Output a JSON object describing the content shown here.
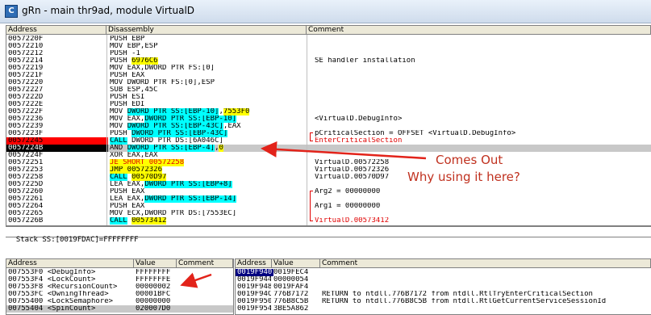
{
  "window": {
    "title": "gRn - main thr9ad, module VirtualD",
    "icon": "C"
  },
  "disasm": {
    "headers": [
      "Address",
      "Disassembly",
      "Comment"
    ],
    "rows": [
      {
        "addr": "0057220F",
        "asm": [
          {
            "t": "PUSH EBP"
          }
        ],
        "comment": ""
      },
      {
        "addr": "00572210",
        "asm": [
          {
            "t": "MOV EBP,ESP"
          }
        ],
        "comment": ""
      },
      {
        "addr": "00572212",
        "asm": [
          {
            "t": "PUSH -1"
          }
        ],
        "comment": ""
      },
      {
        "addr": "00572214",
        "asm": [
          {
            "t": "PUSH "
          },
          {
            "t": "6976C6",
            "s": "yellow"
          }
        ],
        "comment": "SE handler installation"
      },
      {
        "addr": "00572219",
        "asm": [
          {
            "t": "MOV EAX,DWORD PTR FS:[0]"
          }
        ],
        "comment": ""
      },
      {
        "addr": "0057221F",
        "asm": [
          {
            "t": "PUSH EAX"
          }
        ],
        "comment": ""
      },
      {
        "addr": "00572220",
        "asm": [
          {
            "t": "MOV DWORD PTR FS:[0],ESP"
          }
        ],
        "comment": ""
      },
      {
        "addr": "00572227",
        "asm": [
          {
            "t": "SUB ESP,45C"
          }
        ],
        "comment": ""
      },
      {
        "addr": "0057222D",
        "asm": [
          {
            "t": "PUSH ESI"
          }
        ],
        "comment": ""
      },
      {
        "addr": "0057222E",
        "asm": [
          {
            "t": "PUSH EDI"
          }
        ],
        "comment": ""
      },
      {
        "addr": "0057222F",
        "asm": [
          {
            "t": "MOV "
          },
          {
            "t": "DWORD PTR SS:[EBP-10]",
            "s": "cyan"
          },
          {
            "t": ","
          },
          {
            "t": "7553F0",
            "s": "yellow"
          }
        ],
        "comment": ""
      },
      {
        "addr": "00572236",
        "asm": [
          {
            "t": "MOV EAX,"
          },
          {
            "t": "DWORD PTR SS:[EBP-10]",
            "s": "cyan"
          }
        ],
        "comment": "<VirtualD.DebugInfo>"
      },
      {
        "addr": "00572239",
        "asm": [
          {
            "t": "MOV "
          },
          {
            "t": "DWORD PTR SS:[EBP-43C]",
            "s": "cyan"
          },
          {
            "t": ",EAX"
          }
        ],
        "comment": ""
      },
      {
        "addr": "0057223F",
        "asm": [
          {
            "t": "PUSH "
          },
          {
            "t": "DWORD PTR SS:[EBP-43C]",
            "s": "cyan"
          }
        ],
        "comment": "pCriticalSection = OFFSET <VirtualD.DebugInfo>",
        "bracket": "top"
      },
      {
        "addr": "00572245",
        "asm": [
          {
            "t": "CALL",
            "s": "cyan"
          },
          {
            "t": " DWORD PTR DS:[6A046C]"
          }
        ],
        "comment": "EnterCriticalSection",
        "commentColor": "red",
        "addrSel": "red"
      },
      {
        "addr": "0057224B",
        "asm": [
          {
            "t": "AND "
          },
          {
            "t": "DWORD PTR SS:[EBP-4]",
            "s": "cyan"
          },
          {
            "t": ","
          },
          {
            "t": "0",
            "s": "yellow"
          }
        ],
        "comment": "",
        "addrSel": "black",
        "rowSel": "gray"
      },
      {
        "addr": "0057224F",
        "asm": [
          {
            "t": "XOR EAX,EAX"
          }
        ],
        "comment": ""
      },
      {
        "addr": "00572251",
        "asm": [
          {
            "t": "JE SHORT 00572258",
            "s": "yellow",
            "red": true
          }
        ],
        "comment": "VirtualD.00572258"
      },
      {
        "addr": "00572253",
        "asm": [
          {
            "t": "JMP 00572326",
            "s": "yellow"
          }
        ],
        "comment": "VirtualD.00572326"
      },
      {
        "addr": "00572258",
        "asm": [
          {
            "t": "CALL",
            "s": "cyan"
          },
          {
            "t": " "
          },
          {
            "t": "00570D97",
            "s": "yellow"
          }
        ],
        "comment": "VirtualD.00570D97"
      },
      {
        "addr": "0057225D",
        "asm": [
          {
            "t": "LEA EAX,"
          },
          {
            "t": "DWORD PTR SS:[EBP+8]",
            "s": "cyan"
          }
        ],
        "comment": ""
      },
      {
        "addr": "00572260",
        "asm": [
          {
            "t": "PUSH EAX"
          }
        ],
        "comment": "Arg2 = 00000000"
      },
      {
        "addr": "00572261",
        "asm": [
          {
            "t": "LEA EAX,"
          },
          {
            "t": "DWORD PTR SS:[EBP-14]",
            "s": "cyan"
          }
        ],
        "comment": ""
      },
      {
        "addr": "00572264",
        "asm": [
          {
            "t": "PUSH EAX"
          }
        ],
        "comment": "Arg1 = 00000000"
      },
      {
        "addr": "00572265",
        "asm": [
          {
            "t": "MOV ECX,DWORD PTR DS:[7553EC]"
          }
        ],
        "comment": ""
      },
      {
        "addr": "0057226B",
        "asm": [
          {
            "t": "CALL",
            "s": "cyan"
          },
          {
            "t": " "
          },
          {
            "t": "00573412",
            "s": "yellow"
          }
        ],
        "comment": "VirtualD.00573412",
        "commentColor": "red"
      }
    ]
  },
  "info_bar": "Stack SS:[0019FDAC]=FFFFFFFF",
  "dump": {
    "headers": [
      "Address",
      "Value",
      "Comment"
    ],
    "rows": [
      {
        "addr": "007553F0 <DebugInfo>",
        "value": "FFFFFFFF"
      },
      {
        "addr": "007553F4 <LockCount>",
        "value": "FFFFFFFE"
      },
      {
        "addr": "007553F8 <RecursionCount>",
        "value": "00000002"
      },
      {
        "addr": "007553FC <OwningThread>",
        "value": "00001BFC"
      },
      {
        "addr": "00755400 <LockSemaphore>",
        "value": "00000000"
      },
      {
        "addr": "00755404 <SpinCount>",
        "value": "020007D0",
        "sel": true
      }
    ]
  },
  "stack": {
    "headers": [
      "Address",
      "Value",
      "Comment"
    ],
    "rows": [
      {
        "addr": "0019F940",
        "value": "0019FEC4",
        "comment": "",
        "sel": true
      },
      {
        "addr": "0019F944",
        "value": "00000054",
        "comment": ""
      },
      {
        "addr": "0019F948",
        "value": "0019FAF4",
        "comment": ""
      },
      {
        "addr": "0019F94C",
        "value": "776B7172",
        "comment": "RETURN to ntdll.776B7172 from ntdll.RtlTryEnterCriticalSection"
      },
      {
        "addr": "0019F950",
        "value": "776B8C5B",
        "comment": "RETURN to ntdll.776B8C5B from ntdll.RtlGetCurrentServiceSessionId"
      },
      {
        "addr": "0019F954",
        "value": "3BE5A862",
        "comment": ""
      }
    ]
  },
  "annotations": {
    "line1": "Comes Out",
    "line2": "Why using it here?"
  },
  "colors": {
    "arrow": "#e2231a",
    "text": "#c0311f",
    "selection": "#000080"
  }
}
